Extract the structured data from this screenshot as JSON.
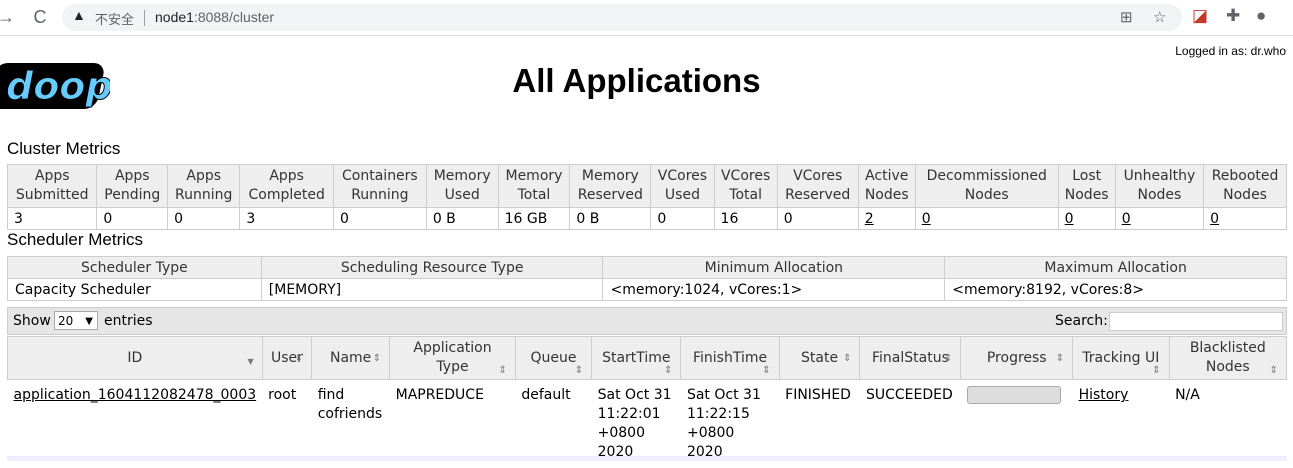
{
  "browser": {
    "back_glyph": "→",
    "reload_glyph": "C",
    "insecure_label": "不安全",
    "url_host": "node1",
    "url_rest": ":8088/cluster"
  },
  "header": {
    "logo_text": "doop",
    "logged_in": "Logged in as: dr.who",
    "title": "All Applications"
  },
  "cluster_metrics": {
    "title": "Cluster Metrics",
    "headers": [
      [
        "Apps",
        "Submitted"
      ],
      [
        "Apps",
        "Pending"
      ],
      [
        "Apps",
        "Running"
      ],
      [
        "Apps",
        "Completed"
      ],
      [
        "Containers",
        "Running"
      ],
      [
        "Memory",
        "Used"
      ],
      [
        "Memory",
        "Total"
      ],
      [
        "Memory",
        "Reserved"
      ],
      [
        "VCores",
        "Used"
      ],
      [
        "VCores",
        "Total"
      ],
      [
        "VCores",
        "Reserved"
      ],
      [
        "Active",
        "Nodes"
      ],
      [
        "Decommissioned",
        "Nodes"
      ],
      [
        "Lost",
        "Nodes"
      ],
      [
        "Unhealthy",
        "Nodes"
      ],
      [
        "Rebooted",
        "Nodes"
      ]
    ],
    "values": [
      "3",
      "0",
      "0",
      "3",
      "0",
      "0 B",
      "16 GB",
      "0 B",
      "0",
      "16",
      "0",
      "2",
      "0",
      "0",
      "0",
      "0"
    ],
    "links": [
      false,
      false,
      false,
      false,
      false,
      false,
      false,
      false,
      false,
      false,
      false,
      true,
      true,
      true,
      true,
      true
    ]
  },
  "scheduler_metrics": {
    "title": "Scheduler Metrics",
    "headers": [
      "Scheduler Type",
      "Scheduling Resource Type",
      "Minimum Allocation",
      "Maximum Allocation"
    ],
    "values": [
      "Capacity Scheduler",
      "[MEMORY]",
      "<memory:1024, vCores:1>",
      "<memory:8192, vCores:8>"
    ]
  },
  "table_controls": {
    "show_label": "Show",
    "page_size": "20",
    "entries_label": "entries",
    "search_label": "Search:"
  },
  "apps_table": {
    "headers": [
      [
        "ID"
      ],
      [
        "User"
      ],
      [
        "Name"
      ],
      [
        "Application",
        "Type"
      ],
      [
        "Queue"
      ],
      [
        "StartTime"
      ],
      [
        "FinishTime"
      ],
      [
        "State"
      ],
      [
        "FinalStatus"
      ],
      [
        "Progress"
      ],
      [
        "Tracking UI"
      ],
      [
        "Blacklisted",
        "Nodes"
      ]
    ],
    "rows": [
      {
        "id": "application_1604112082478_0003",
        "user": "root",
        "name": "find cofriends",
        "type": "MAPREDUCE",
        "queue": "default",
        "start": "Sat Oct 31 11:22:01 +0800 2020",
        "finish": "Sat Oct 31 11:22:15 +0800 2020",
        "state": "FINISHED",
        "final_status": "SUCCEEDED",
        "progress": 100,
        "tracking": "History",
        "blacklisted": "N/A"
      }
    ]
  }
}
